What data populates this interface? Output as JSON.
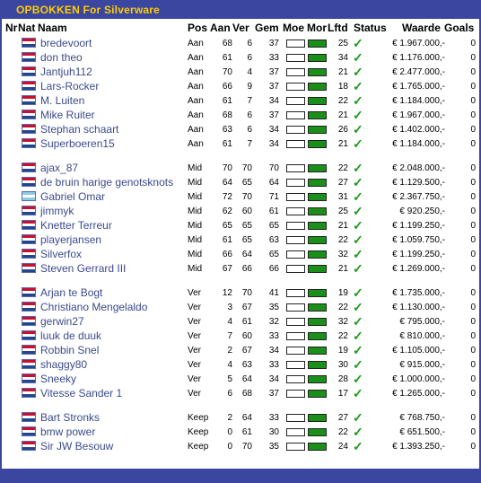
{
  "title": "OPBOKKEN For Silverware",
  "headers": {
    "nr": "Nr",
    "nat": "Nat",
    "naam": "Naam",
    "pos": "Pos",
    "aan": "Aan",
    "ver": "Ver",
    "gem": "Gem",
    "moe": "Moe",
    "mor": "Mor",
    "lftd": "Lftd",
    "status": "Status",
    "waarde": "Waarde",
    "goals": "Goals"
  },
  "status_icon": "checkmark-icon",
  "status_glyph": "✓",
  "colors": {
    "frame": "#3a46a0",
    "title": "#ffcc00",
    "name": "#3b4a8c",
    "bar_fill": "#1a8f1a",
    "check": "#1a9a1a"
  },
  "groups": [
    {
      "players": [
        {
          "nat": "nl",
          "name": "bredevoort",
          "pos": "Aan",
          "aan": "68",
          "ver": "6",
          "gem": "37",
          "moe": 0,
          "mor": 1,
          "lftd": "25",
          "waarde": "€ 1.967.000,-",
          "goals": "0"
        },
        {
          "nat": "nl",
          "name": "don theo",
          "pos": "Aan",
          "aan": "61",
          "ver": "6",
          "gem": "33",
          "moe": 0,
          "mor": 1,
          "lftd": "34",
          "waarde": "€ 1.176.000,-",
          "goals": "0"
        },
        {
          "nat": "nl",
          "name": "Jantjuh112",
          "pos": "Aan",
          "aan": "70",
          "ver": "4",
          "gem": "37",
          "moe": 0,
          "mor": 1,
          "lftd": "21",
          "waarde": "€ 2.477.000,-",
          "goals": "0"
        },
        {
          "nat": "nl",
          "name": "Lars-Rocker",
          "pos": "Aan",
          "aan": "66",
          "ver": "9",
          "gem": "37",
          "moe": 0,
          "mor": 1,
          "lftd": "18",
          "waarde": "€ 1.765.000,-",
          "goals": "0"
        },
        {
          "nat": "nl",
          "name": "M. Luiten",
          "pos": "Aan",
          "aan": "61",
          "ver": "7",
          "gem": "34",
          "moe": 0,
          "mor": 1,
          "lftd": "22",
          "waarde": "€ 1.184.000,-",
          "goals": "0"
        },
        {
          "nat": "nl",
          "name": "Mike Ruiter",
          "pos": "Aan",
          "aan": "68",
          "ver": "6",
          "gem": "37",
          "moe": 0,
          "mor": 1,
          "lftd": "21",
          "waarde": "€ 1.967.000,-",
          "goals": "0"
        },
        {
          "nat": "nl",
          "name": "Stephan schaart",
          "pos": "Aan",
          "aan": "63",
          "ver": "6",
          "gem": "34",
          "moe": 0,
          "mor": 1,
          "lftd": "26",
          "waarde": "€ 1.402.000,-",
          "goals": "0"
        },
        {
          "nat": "nl",
          "name": "Superboeren15",
          "pos": "Aan",
          "aan": "61",
          "ver": "7",
          "gem": "34",
          "moe": 0,
          "mor": 1,
          "lftd": "21",
          "waarde": "€ 1.184.000,-",
          "goals": "0"
        }
      ]
    },
    {
      "players": [
        {
          "nat": "nl",
          "name": "ajax_87",
          "pos": "Mid",
          "aan": "70",
          "ver": "70",
          "gem": "70",
          "moe": 0,
          "mor": 1,
          "lftd": "22",
          "waarde": "€ 2.048.000,-",
          "goals": "0"
        },
        {
          "nat": "nl",
          "name": "de bruin harige genotsknots",
          "pos": "Mid",
          "aan": "64",
          "ver": "65",
          "gem": "64",
          "moe": 0,
          "mor": 1,
          "lftd": "27",
          "waarde": "€ 1.129.500,-",
          "goals": "0"
        },
        {
          "nat": "ar",
          "name": "Gabriel Omar",
          "pos": "Mid",
          "aan": "72",
          "ver": "70",
          "gem": "71",
          "moe": 0,
          "mor": 1,
          "lftd": "31",
          "waarde": "€ 2.367.750,-",
          "goals": "0"
        },
        {
          "nat": "nl",
          "name": "jimmyk",
          "pos": "Mid",
          "aan": "62",
          "ver": "60",
          "gem": "61",
          "moe": 0,
          "mor": 1,
          "lftd": "25",
          "waarde": "€ 920.250,-",
          "goals": "0"
        },
        {
          "nat": "nl",
          "name": "Knetter Terreur",
          "pos": "Mid",
          "aan": "65",
          "ver": "65",
          "gem": "65",
          "moe": 0,
          "mor": 1,
          "lftd": "21",
          "waarde": "€ 1.199.250,-",
          "goals": "0"
        },
        {
          "nat": "nl",
          "name": "playerjansen",
          "pos": "Mid",
          "aan": "61",
          "ver": "65",
          "gem": "63",
          "moe": 0,
          "mor": 1,
          "lftd": "22",
          "waarde": "€ 1.059.750,-",
          "goals": "0"
        },
        {
          "nat": "nl",
          "name": "Silverfox",
          "pos": "Mid",
          "aan": "66",
          "ver": "64",
          "gem": "65",
          "moe": 0,
          "mor": 1,
          "lftd": "32",
          "waarde": "€ 1.199.250,-",
          "goals": "0"
        },
        {
          "nat": "nl",
          "name": "Steven Gerrard III",
          "pos": "Mid",
          "aan": "67",
          "ver": "66",
          "gem": "66",
          "moe": 0,
          "mor": 1,
          "lftd": "21",
          "waarde": "€ 1.269.000,-",
          "goals": "0"
        }
      ]
    },
    {
      "players": [
        {
          "nat": "nl",
          "name": "Arjan te Bogt",
          "pos": "Ver",
          "aan": "12",
          "ver": "70",
          "gem": "41",
          "moe": 0,
          "mor": 1,
          "lftd": "19",
          "waarde": "€ 1.735.000,-",
          "goals": "0"
        },
        {
          "nat": "nl",
          "name": "Christiano Mengelaldo",
          "pos": "Ver",
          "aan": "3",
          "ver": "67",
          "gem": "35",
          "moe": 0,
          "mor": 1,
          "lftd": "22",
          "waarde": "€ 1.130.000,-",
          "goals": "0"
        },
        {
          "nat": "nl",
          "name": "gerwin27",
          "pos": "Ver",
          "aan": "4",
          "ver": "61",
          "gem": "32",
          "moe": 0,
          "mor": 1,
          "lftd": "32",
          "waarde": "€ 795.000,-",
          "goals": "0"
        },
        {
          "nat": "nl",
          "name": "luuk de duuk",
          "pos": "Ver",
          "aan": "7",
          "ver": "60",
          "gem": "33",
          "moe": 0,
          "mor": 1,
          "lftd": "22",
          "waarde": "€ 810.000,-",
          "goals": "0"
        },
        {
          "nat": "nl",
          "name": "Robbin Snel",
          "pos": "Ver",
          "aan": "2",
          "ver": "67",
          "gem": "34",
          "moe": 0,
          "mor": 1,
          "lftd": "19",
          "waarde": "€ 1.105.000,-",
          "goals": "0"
        },
        {
          "nat": "nl",
          "name": "shaggy80",
          "pos": "Ver",
          "aan": "4",
          "ver": "63",
          "gem": "33",
          "moe": 0,
          "mor": 1,
          "lftd": "30",
          "waarde": "€ 915.000,-",
          "goals": "0"
        },
        {
          "nat": "nl",
          "name": "Sneeky",
          "pos": "Ver",
          "aan": "5",
          "ver": "64",
          "gem": "34",
          "moe": 0,
          "mor": 1,
          "lftd": "28",
          "waarde": "€ 1.000.000,-",
          "goals": "0"
        },
        {
          "nat": "nl",
          "name": "Vitesse Sander 1",
          "pos": "Ver",
          "aan": "6",
          "ver": "68",
          "gem": "37",
          "moe": 0,
          "mor": 1,
          "lftd": "17",
          "waarde": "€ 1.265.000,-",
          "goals": "0"
        }
      ]
    },
    {
      "players": [
        {
          "nat": "nl",
          "name": "Bart Stronks",
          "pos": "Keep",
          "aan": "2",
          "ver": "64",
          "gem": "33",
          "moe": 0,
          "mor": 1,
          "lftd": "27",
          "waarde": "€ 768.750,-",
          "goals": "0"
        },
        {
          "nat": "nl",
          "name": "bmw power",
          "pos": "Keep",
          "aan": "0",
          "ver": "61",
          "gem": "30",
          "moe": 0,
          "mor": 1,
          "lftd": "22",
          "waarde": "€ 651.500,-",
          "goals": "0"
        },
        {
          "nat": "nl",
          "name": "Sir JW Besouw",
          "pos": "Keep",
          "aan": "0",
          "ver": "70",
          "gem": "35",
          "moe": 0,
          "mor": 1,
          "lftd": "24",
          "waarde": "€ 1.393.250,-",
          "goals": "0"
        }
      ]
    }
  ]
}
